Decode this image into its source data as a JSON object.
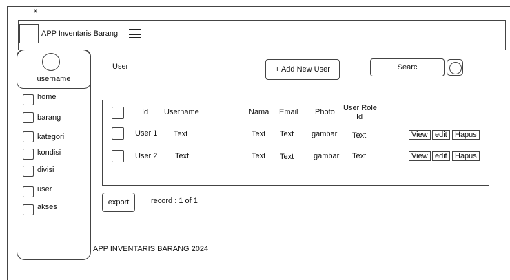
{
  "window": {
    "close_label": "x"
  },
  "header": {
    "logo_alt": "",
    "app_title": "APP Inventaris Barang",
    "menu_icon": "hamburger-icon"
  },
  "sidebar": {
    "username": "username",
    "items": [
      {
        "label": "home"
      },
      {
        "label": "barang"
      },
      {
        "label": "kategori"
      },
      {
        "label": "kondisi"
      },
      {
        "label": "divisi"
      },
      {
        "label": "user"
      },
      {
        "label": "akses"
      }
    ]
  },
  "main": {
    "title": "User",
    "add_button": "+ Add New User",
    "search_value": "Searc",
    "table": {
      "headers": {
        "id": "Id",
        "username": "Username",
        "nama": "Nama",
        "email": "Email",
        "photo": "Photo",
        "role_line1": "User Role",
        "role_line2": "Id"
      },
      "rows": [
        {
          "id": "User 1",
          "username": "Text",
          "nama": "Text",
          "email": "Text",
          "photo": "gambar",
          "role": "Text",
          "view": "View",
          "edit": "edit",
          "hapus": "Hapus"
        },
        {
          "id": "User 2",
          "username": "Text",
          "nama": "Text",
          "email": "Text",
          "photo": "gambar",
          "role": "Text",
          "view": "View",
          "edit": "edit",
          "hapus": "Hapus"
        }
      ]
    },
    "export_button": "export",
    "record_text": "record : 1 of 1"
  },
  "footer": {
    "text": "APP INVENTARIS BARANG 2024"
  }
}
